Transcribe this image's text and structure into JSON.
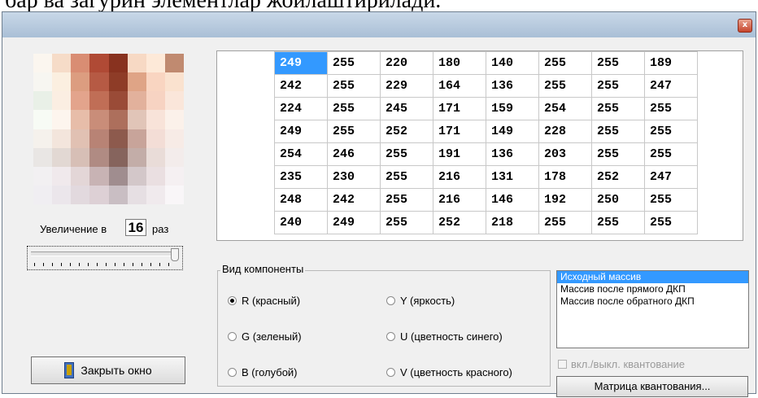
{
  "doc_text": "бар ва загурин элементлар жойлаштирилади.",
  "close_glyph": "x",
  "pixel_colors": [
    "#fbf6ef",
    "#f6dcc8",
    "#d98d73",
    "#b04a35",
    "#88321f",
    "#f7d9c4",
    "#fde9d8",
    "#c08a70",
    "#f7f6f1",
    "#fbefe0",
    "#dc9d80",
    "#b65a44",
    "#8e3c27",
    "#dfa486",
    "#f9d5c1",
    "#fae2cf",
    "#e9f0e7",
    "#fbeee2",
    "#e3a48c",
    "#c06e56",
    "#9a4b37",
    "#e2b19c",
    "#f7d3c2",
    "#fae6da",
    "#f7fbf5",
    "#fdf5ee",
    "#e7bda9",
    "#c98d79",
    "#ad6f5c",
    "#e1c5b8",
    "#f8e3d9",
    "#fbf1ea",
    "#f5f1ec",
    "#f3e5dc",
    "#e1c1b3",
    "#b88375",
    "#8d5a4d",
    "#c8a49a",
    "#f3ddd6",
    "#f7ebe6",
    "#e9e6e4",
    "#e2d8d3",
    "#d7bfb6",
    "#b08b83",
    "#86645d",
    "#c3ada8",
    "#e9dcd8",
    "#f3eceb",
    "#f2f0f2",
    "#f0e9ec",
    "#e3d6d7",
    "#c8b3b4",
    "#a08d8f",
    "#d3c7c9",
    "#eadfe1",
    "#f5f0f2",
    "#f0eef2",
    "#ebe6eb",
    "#e2d9de",
    "#ddd0d5",
    "#c9bec3",
    "#e6dfe3",
    "#f0eaed",
    "#f9f6f8"
  ],
  "zoom": {
    "prefix": "Увеличение в",
    "value": "16",
    "suffix": "раз"
  },
  "close_button_label": "Закрыть окно",
  "matrix": [
    [
      "249",
      "255",
      "220",
      "180",
      "140",
      "255",
      "255",
      "189"
    ],
    [
      "242",
      "255",
      "229",
      "164",
      "136",
      "255",
      "255",
      "247"
    ],
    [
      "224",
      "255",
      "245",
      "171",
      "159",
      "254",
      "255",
      "255"
    ],
    [
      "249",
      "255",
      "252",
      "171",
      "149",
      "228",
      "255",
      "255"
    ],
    [
      "254",
      "246",
      "255",
      "191",
      "136",
      "203",
      "255",
      "255"
    ],
    [
      "235",
      "230",
      "255",
      "216",
      "131",
      "178",
      "252",
      "247"
    ],
    [
      "248",
      "242",
      "255",
      "216",
      "146",
      "192",
      "250",
      "255"
    ],
    [
      "240",
      "249",
      "255",
      "252",
      "218",
      "255",
      "255",
      "255"
    ]
  ],
  "component_group": {
    "title": "Вид компоненты",
    "options": [
      {
        "label": "R (красный)",
        "checked": true
      },
      {
        "label": "Y (яркость)",
        "checked": false
      },
      {
        "label": "G (зеленый)",
        "checked": false
      },
      {
        "label": "U (цветность синего)",
        "checked": false
      },
      {
        "label": "B (голубой)",
        "checked": false
      },
      {
        "label": "V (цветность красного)",
        "checked": false
      }
    ]
  },
  "array_list": {
    "items": [
      "Исходный массив",
      "Массив после прямого ДКП",
      "Массив после обратного ДКП"
    ],
    "selected_index": 0
  },
  "quantization_checkbox": {
    "label": "вкл./выкл. квантование",
    "checked": false,
    "enabled": false
  },
  "quant_matrix_button_label": "Матрица квантования..."
}
